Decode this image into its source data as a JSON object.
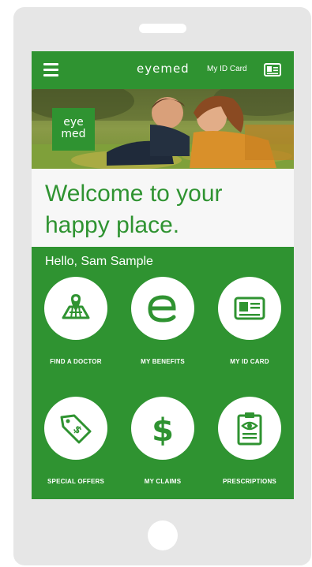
{
  "header": {
    "menu_icon": "hamburger-menu-icon",
    "brand": "eyemed",
    "id_card_link": "My ID Card",
    "id_card_icon": "id-card-icon"
  },
  "hero": {
    "logo_line1": "eye",
    "logo_line2": "med"
  },
  "welcome": {
    "headline": "Welcome to your happy place."
  },
  "greeting": "Hello, Sam Sample",
  "tiles": [
    {
      "label": "FIND A DOCTOR",
      "icon": "map-pin-icon"
    },
    {
      "label": "MY BENEFITS",
      "icon": "eyemed-e-icon"
    },
    {
      "label": "MY ID CARD",
      "icon": "id-card-icon"
    },
    {
      "label": "SPECIAL OFFERS",
      "icon": "price-tag-icon"
    },
    {
      "label": "MY CLAIMS",
      "icon": "dollar-icon"
    },
    {
      "label": "PRESCRIPTIONS",
      "icon": "prescription-clipboard-icon"
    }
  ],
  "colors": {
    "brand_green": "#2f9331",
    "device_frame": "#e6e6e6",
    "welcome_bg": "#f7f7f7"
  }
}
